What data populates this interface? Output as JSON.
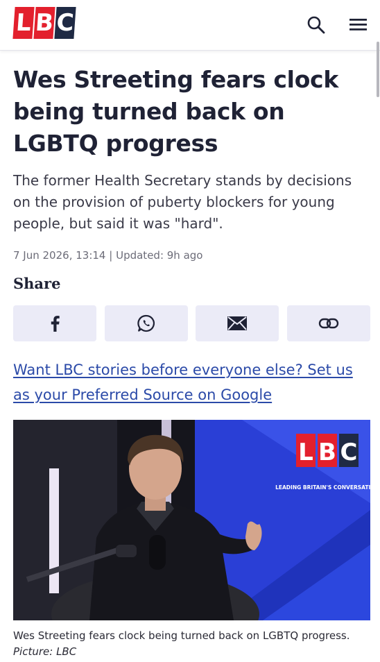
{
  "header": {
    "logo_letters": [
      "L",
      "B",
      "C"
    ],
    "search_icon": "search-icon",
    "menu_icon": "hamburger-menu-icon"
  },
  "article": {
    "headline": "Wes Streeting fears clock being turned back on LGBTQ progress",
    "standfirst": "The former Health Secretary stands by decisions on the provision of puberty blockers for young people, but said it was \"hard\".",
    "published": "7 Jun 2026, 13:14",
    "separator": "|",
    "updated": "Updated: 9h ago"
  },
  "share": {
    "label": "Share",
    "buttons": [
      {
        "icon": "facebook-icon"
      },
      {
        "icon": "whatsapp-icon"
      },
      {
        "icon": "email-icon"
      },
      {
        "icon": "link-icon"
      }
    ]
  },
  "promo": {
    "text": "Want LBC stories before everyone else? Set us as your Preferred Source on Google"
  },
  "image": {
    "logo_letters": [
      "L",
      "B",
      "C"
    ],
    "tagline": "LEADING BRITAIN'S CONVERSATION",
    "caption": "Wes Streeting fears clock being turned back on LGBTQ progress.",
    "credit": "Picture: LBC"
  },
  "colors": {
    "brand_red": "#e3202d",
    "brand_navy": "#1f2a44",
    "link_blue": "#2b4aa8",
    "share_button_bg": "#ebebf7",
    "studio_blue": "#2a3fd6"
  }
}
